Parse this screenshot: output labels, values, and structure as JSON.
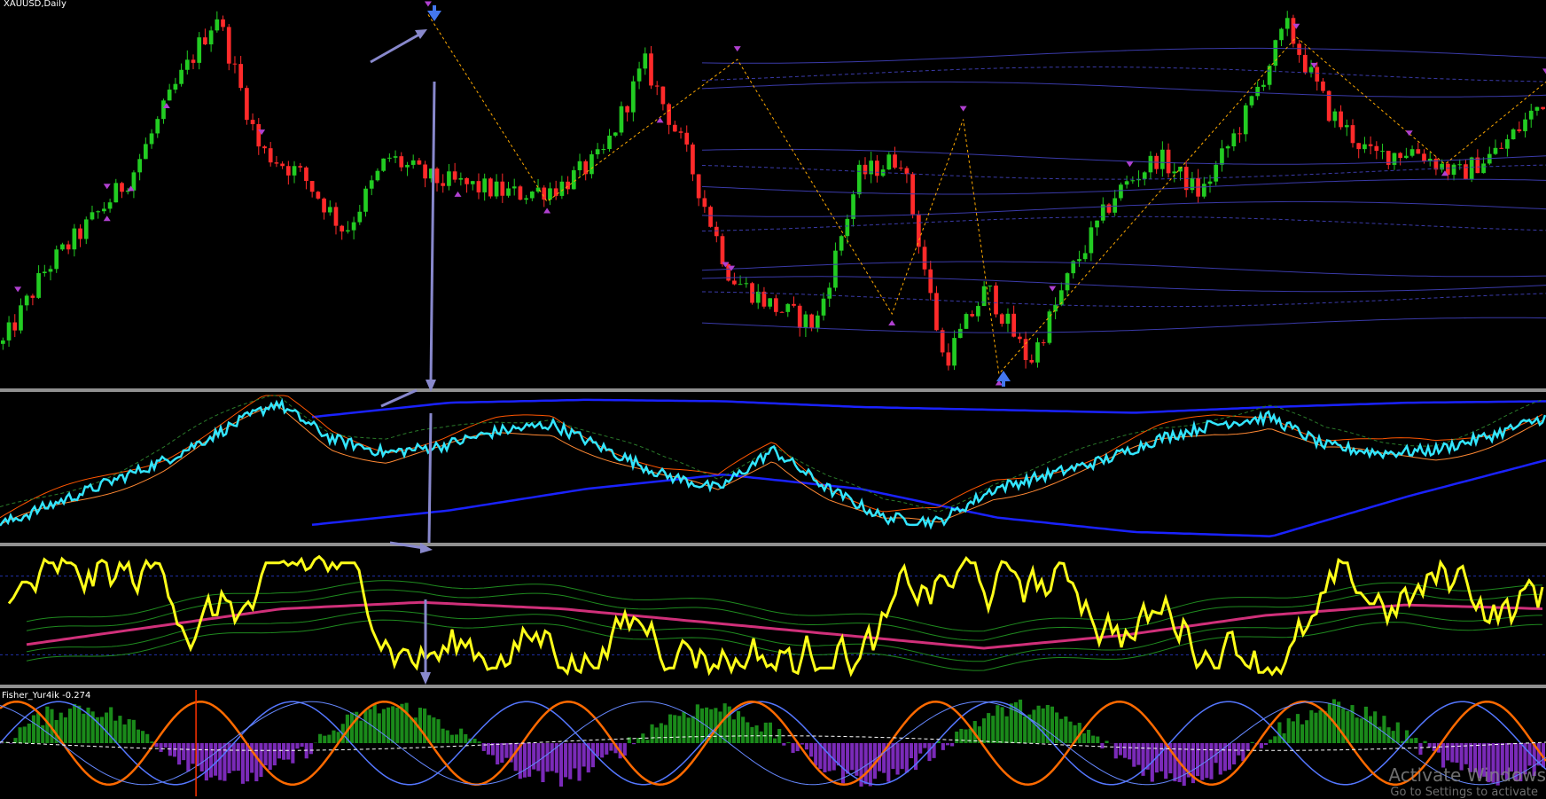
{
  "window": {
    "symbol_label": "XAUUSD,Daily",
    "fisher_label": "Fisher_Yur4ik -0.274"
  },
  "watermark": {
    "line1": "Activate Windows",
    "line2": "Go to Settings to activate"
  },
  "colors": {
    "background": "#000000",
    "bull_candle": "#22cc22",
    "bear_candle": "#ff2a2a",
    "zigzag": "#ffaa00",
    "envelope": "#3a3aa8",
    "arrow_marker": "#b040d0",
    "signal_arrow": "#4477ee",
    "annotation": "#8888cc",
    "separator": "#909090",
    "momentum_line": "#33e6ff",
    "band": "#1a22ff",
    "oscillator": "#ffff1a",
    "osc_center": "#d0307a",
    "histogram_up": "#1a8a1a",
    "histogram_down": "#7a2ab8",
    "fisher_fast": "#ff6a00",
    "fisher_slow": "#5577ff",
    "vline": "#ff3300"
  },
  "chart_data": [
    {
      "type": "candlestick",
      "name": "main",
      "bars": 260,
      "close_profile": [
        0.1,
        0.3,
        0.42,
        0.55,
        0.78,
        0.98,
        0.62,
        0.55,
        0.4,
        0.6,
        0.54,
        0.52,
        0.5,
        0.52,
        0.6,
        0.85,
        0.6,
        0.28,
        0.2,
        0.15,
        0.55,
        0.6,
        0.05,
        0.25,
        0.05,
        0.3,
        0.5,
        0.6,
        0.5,
        0.7,
        0.95,
        0.72,
        0.6,
        0.62,
        0.55,
        0.62,
        0.75
      ],
      "zigzag_pivots": [
        [
          72,
          0.98
        ],
        [
          92,
          0.48
        ],
        [
          124,
          0.86
        ],
        [
          150,
          0.18
        ],
        [
          162,
          0.7
        ],
        [
          168,
          0.02
        ],
        [
          218,
          0.92
        ],
        [
          243,
          0.58
        ],
        [
          260,
          0.8
        ]
      ]
    },
    {
      "type": "line",
      "name": "momentum",
      "profile": [
        0.1,
        0.25,
        0.4,
        0.55,
        0.75,
        0.95,
        0.7,
        0.6,
        0.65,
        0.75,
        0.8,
        0.62,
        0.45,
        0.35,
        0.62,
        0.35,
        0.15,
        0.12,
        0.35,
        0.45,
        0.55,
        0.7,
        0.8,
        0.85,
        0.65,
        0.6,
        0.62,
        0.72,
        0.85
      ],
      "band_upper": [
        0.85,
        0.95,
        0.97,
        0.96,
        0.92,
        0.9,
        0.88,
        0.92,
        0.95,
        0.96
      ],
      "band_lower": [
        0.1,
        0.2,
        0.35,
        0.45,
        0.35,
        0.15,
        0.05,
        0.02,
        0.3,
        0.55
      ]
    },
    {
      "type": "line",
      "name": "oscillator",
      "levels": [
        0.8,
        0.2
      ],
      "center_profile": [
        0.25,
        0.4,
        0.55,
        0.6,
        0.55,
        0.45,
        0.35,
        0.25,
        0.35,
        0.5,
        0.58,
        0.55
      ]
    },
    {
      "type": "bar",
      "name": "fisher",
      "series_names": [
        "fisher_fast",
        "fisher_slow",
        "histogram"
      ],
      "vline_bar": 33
    }
  ]
}
